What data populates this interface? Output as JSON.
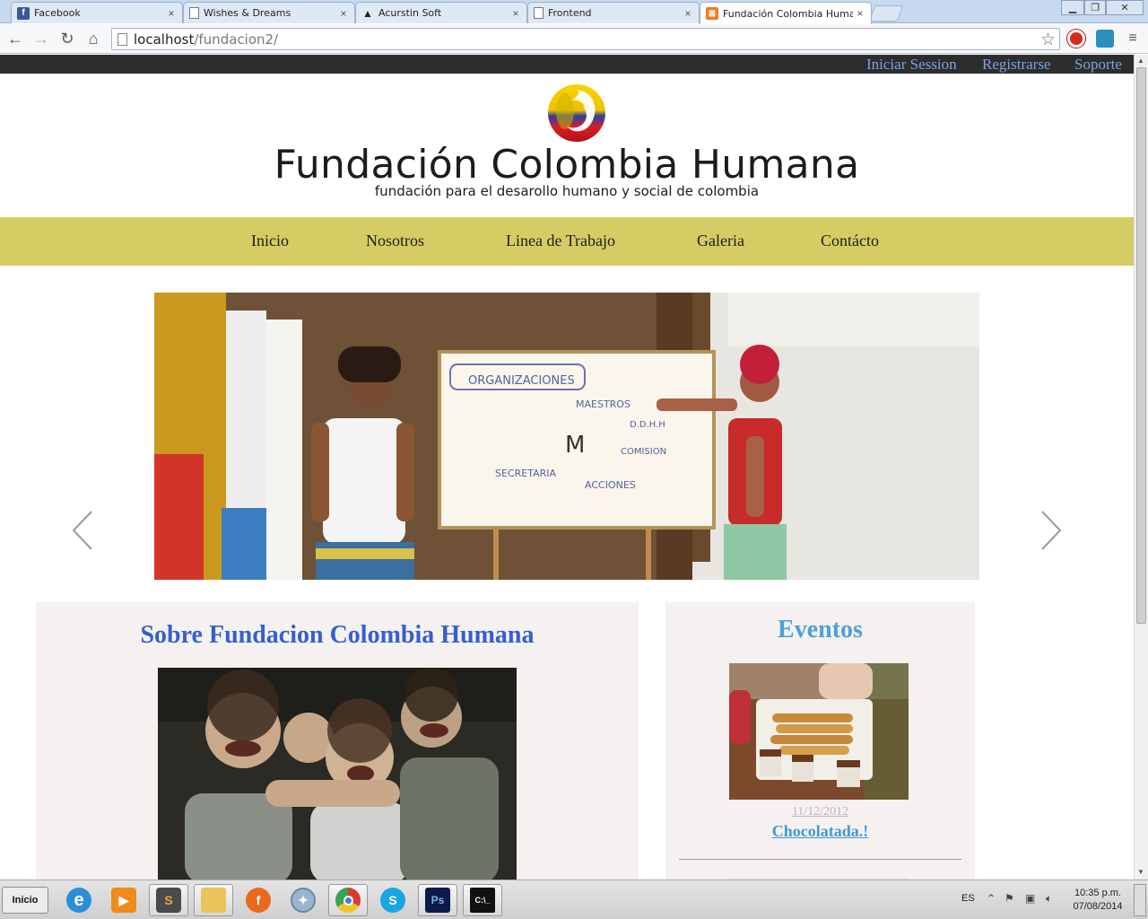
{
  "browser": {
    "tabs": [
      {
        "title": "Facebook",
        "favicon": "facebook-icon",
        "active": false
      },
      {
        "title": "Wishes & Dreams",
        "favicon": "page-icon",
        "active": false
      },
      {
        "title": "Acurstin Soft",
        "favicon": "acurstin-icon",
        "active": false
      },
      {
        "title": "Frontend",
        "favicon": "page-icon",
        "active": false
      },
      {
        "title": "Fundación Colombia Humana",
        "favicon": "xampp-icon",
        "active": true
      }
    ],
    "address": {
      "host": "localhost",
      "path": "/fundacion2/"
    },
    "close_glyph": "×"
  },
  "site": {
    "topbar": {
      "login": "Iniciar Session",
      "register": "Registrarse",
      "support": "Soporte"
    },
    "title": "Fundación Colombia Humana",
    "subtitle": "fundación para el desarollo humano y social de colombia",
    "nav": {
      "home": "Inicio",
      "about": "Nosotros",
      "work": "Linea de Trabajo",
      "gallery": "Galeria",
      "contact": "Contácto"
    },
    "about": {
      "heading": "Sobre Fundacion Colombia Humana"
    },
    "events": {
      "heading": "Eventos",
      "items": [
        {
          "date": "11/12/2012",
          "name": "Chocolatada.!"
        }
      ]
    },
    "colors": {
      "topbar_bg": "#2d2d2d",
      "nav_bg": "#d5cd63",
      "link_blue": "#7aa3e8",
      "heading_blue": "#3560cc",
      "events_blue": "#4ea0d6",
      "panel_bg": "#f5f1f0"
    }
  },
  "taskbar": {
    "start_label": "Inicio",
    "language": "ES",
    "time": "10:35 p.m.",
    "date": "07/08/2014",
    "apps": [
      "internet-explorer-icon",
      "media-player-icon",
      "sublime-text-icon",
      "file-explorer-icon",
      "firefox-icon",
      "safari-icon",
      "chrome-icon",
      "skype-icon",
      "photoshop-icon",
      "command-prompt-icon"
    ]
  }
}
